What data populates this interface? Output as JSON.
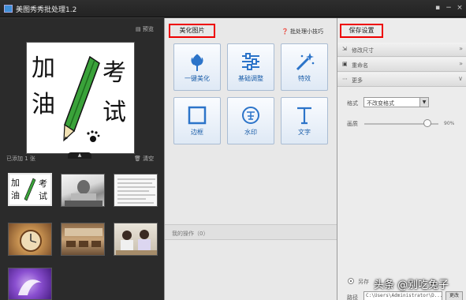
{
  "window": {
    "title": "美图秀秀批处理1.2",
    "controls": [
      "▪",
      "−",
      "×"
    ]
  },
  "left_panel": {
    "preview_link": "预览",
    "added_label": "已添加 1 张",
    "clear_label": "清空",
    "collapse_glyph": "▲",
    "preview_image": {
      "chars": [
        "加",
        "油",
        "考",
        "试"
      ],
      "colors": {
        "pencil": "#3aa23a",
        "ink": "#111111"
      }
    },
    "thumbnails": [
      {
        "name": "poster-thumb"
      },
      {
        "name": "child-thumb"
      },
      {
        "name": "document-thumb"
      },
      {
        "name": "clock-thumb"
      },
      {
        "name": "classroom-thumb"
      },
      {
        "name": "students-thumb"
      },
      {
        "name": "purple-thumb"
      }
    ]
  },
  "center_panel": {
    "tab_label": "美化图片",
    "tips_link": "批处理小技巧",
    "tools": [
      {
        "label": "一键美化",
        "icon": "tulip-icon"
      },
      {
        "label": "基础调整",
        "icon": "sliders-icon"
      },
      {
        "label": "特效",
        "icon": "magic-wand-icon"
      },
      {
        "label": "边框",
        "icon": "frame-icon"
      },
      {
        "label": "水印",
        "icon": "watermark-icon"
      },
      {
        "label": "文字",
        "icon": "text-icon"
      }
    ],
    "ops_label": "我的操作（0）"
  },
  "right_panel": {
    "tab_label": "保存设置",
    "sections": [
      {
        "label": "修改尺寸",
        "icon": "resize-icon"
      },
      {
        "label": "重命名",
        "icon": "rename-icon"
      },
      {
        "label": "更多",
        "icon": "more-icon"
      }
    ],
    "format_label": "格式",
    "format_value": "不改变格式",
    "quality_label": "画质",
    "quality_value": "90%",
    "quality_fraction": 0.85,
    "radio_label": "另存",
    "path_label": "路径",
    "path_value": "C:\\Users\\Administrator\\D...",
    "browse_label": "更改"
  },
  "overlay": {
    "watermark_text": "头条 @别吃兔子"
  },
  "colors": {
    "highlight_box": "#e00000",
    "tool_icon": "#2c74c9",
    "dark_panel": "#2b2b2b"
  }
}
